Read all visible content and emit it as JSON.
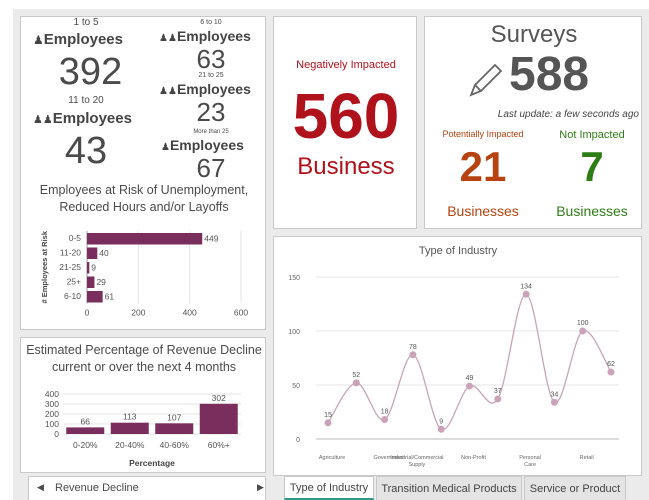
{
  "employees": {
    "g1": {
      "range": "1 to 5",
      "label": "Employees",
      "count": "392",
      "icon": "person-icon"
    },
    "g2": {
      "range": "6 to 10",
      "label": "Employees",
      "count": "63",
      "icon": "people-icon"
    },
    "g3": {
      "range": "11 to 20",
      "label": "Employees",
      "count": "43",
      "icon": "people-icon"
    },
    "g4": {
      "range": "21 to 25",
      "label": "Employees",
      "count": "23",
      "icon": "people-icon"
    },
    "g5": {
      "range": "More than 25",
      "label": "Employees",
      "count": "67",
      "icon": "group-icon"
    },
    "risk_title_1": "Employees at Risk of Unemployment,",
    "risk_title_2": "Reduced Hours and/or Layoffs"
  },
  "negative": {
    "label": "Negatively Impacted",
    "count": "560",
    "unit": "Business"
  },
  "surveys": {
    "title": "Surveys",
    "count": "588",
    "update": "Last update: a few seconds ago",
    "potential_label": "Potentially Impacted",
    "potential_count": "21",
    "potential_unit": "Businesses",
    "not_label": "Not Impacted",
    "not_count": "7",
    "not_unit": "Businesses"
  },
  "revenue_title_1": "Estimated Percentage of Revenue Decline",
  "revenue_title_2": "current or over the next 4 months",
  "bottom_left_nav": {
    "label": "Revenue Decline"
  },
  "tabs": [
    "Type of Industry",
    "Transition Medical Products",
    "Service or Product"
  ],
  "colors": {
    "accent": "#7a2e5e",
    "red": "#b0121b",
    "orange": "#b5420f",
    "green": "#2e7d16",
    "tab_accent": "#2c9c88"
  },
  "chart_data": [
    {
      "type": "bar",
      "orientation": "horizontal",
      "categories": [
        "0-5",
        "11-20",
        "21-25",
        "25+",
        "6-10"
      ],
      "values": [
        449,
        40,
        9,
        29,
        61
      ],
      "ylabel": "# Employees at Risk",
      "xlim": [
        0,
        600
      ],
      "xticks": [
        "0",
        "200",
        "400",
        "600"
      ]
    },
    {
      "type": "bar",
      "categories": [
        "0-20%",
        "20-40%",
        "40-60%",
        "60%+"
      ],
      "values": [
        66,
        113,
        107,
        302
      ],
      "xlabel": "Percentage",
      "ylim": [
        0,
        400
      ],
      "yticks": [
        "0",
        "100",
        "200",
        "300",
        "400"
      ]
    },
    {
      "type": "line",
      "title": "Type of Industry",
      "categories": [
        "Agriculture",
        "",
        "Government",
        "Industrial/Commercial Supply",
        "",
        "Non-Profit",
        "",
        "Personal Care",
        "",
        "Retail"
      ],
      "values": [
        15,
        52,
        18,
        78,
        9,
        49,
        37,
        134,
        34,
        100,
        62
      ],
      "ylim": [
        0,
        150
      ],
      "yticks": [
        "0",
        "50",
        "100",
        "150"
      ]
    }
  ]
}
